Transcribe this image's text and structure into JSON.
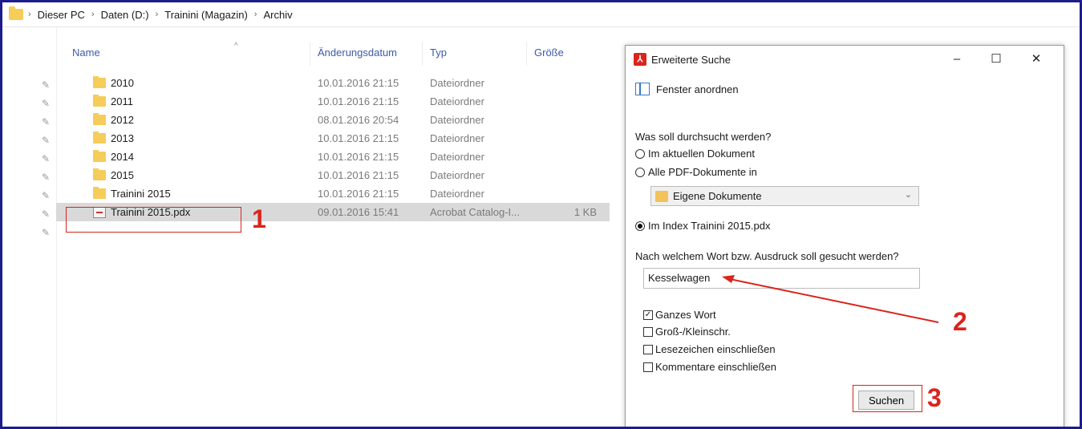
{
  "explorer": {
    "breadcrumb": [
      "Dieser PC",
      "Daten (D:)",
      "Trainini (Magazin)",
      "Archiv"
    ],
    "columns": {
      "name": "Name",
      "date": "Änderungsdatum",
      "type": "Typ",
      "size": "Größe"
    },
    "files": [
      {
        "name": "2010",
        "date": "10.01.2016 21:15",
        "type": "Dateiordner",
        "size": ""
      },
      {
        "name": "2011",
        "date": "10.01.2016 21:15",
        "type": "Dateiordner",
        "size": ""
      },
      {
        "name": "2012",
        "date": "08.01.2016 20:54",
        "type": "Dateiordner",
        "size": ""
      },
      {
        "name": "2013",
        "date": "10.01.2016 21:15",
        "type": "Dateiordner",
        "size": ""
      },
      {
        "name": "2014",
        "date": "10.01.2016 21:15",
        "type": "Dateiordner",
        "size": ""
      },
      {
        "name": "2015",
        "date": "10.01.2016 21:15",
        "type": "Dateiordner",
        "size": ""
      },
      {
        "name": "Trainini 2015",
        "date": "10.01.2016 21:15",
        "type": "Dateiordner",
        "size": ""
      },
      {
        "name": "Trainini 2015.pdx",
        "date": "09.01.2016 15:41",
        "type": "Acrobat Catalog-I...",
        "size": "1 KB"
      }
    ]
  },
  "dialog": {
    "title": "Erweiterte Suche",
    "arrange_label": "Fenster anordnen",
    "search_scope_question": "Was soll durchsucht werden?",
    "options": {
      "current_doc": "Im aktuellen Dokument",
      "all_pdfs": "Alle PDF-Dokumente in",
      "index": "Im Index Trainini 2015.pdx"
    },
    "location_select": "Eigene Dokumente",
    "search_term_question": "Nach welchem Wort bzw. Ausdruck soll gesucht werden?",
    "search_term": "Kesselwagen",
    "checkboxes": {
      "whole_word": "Ganzes Wort",
      "case": "Groß-/Kleinschr.",
      "bookmarks": "Lesezeichen einschließen",
      "comments": "Kommentare einschließen"
    },
    "search_button": "Suchen"
  },
  "annotations": {
    "one": "1",
    "two": "2",
    "three": "3"
  },
  "colors": {
    "annotation": "#d9251d",
    "frame": "#1c1c8c"
  }
}
